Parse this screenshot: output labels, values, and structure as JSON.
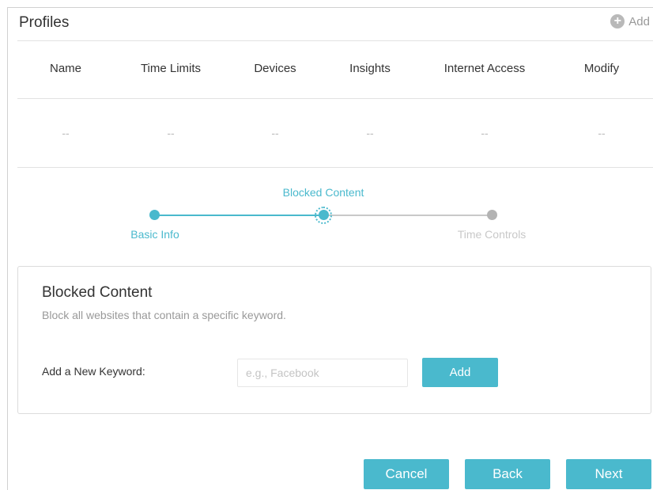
{
  "header": {
    "title": "Profiles",
    "add_label": "Add"
  },
  "table": {
    "columns": [
      "Name",
      "Time Limits",
      "Devices",
      "Insights",
      "Internet Access",
      "Modify"
    ],
    "rows": [
      [
        "--",
        "--",
        "--",
        "--",
        "--",
        "--"
      ]
    ]
  },
  "stepper": {
    "steps": [
      {
        "label": "Basic Info",
        "state": "completed"
      },
      {
        "label": "Blocked Content",
        "state": "active"
      },
      {
        "label": "Time Controls",
        "state": "pending"
      }
    ]
  },
  "card": {
    "title": "Blocked Content",
    "description": "Block all websites that contain a specific keyword.",
    "keyword_label": "Add a New Keyword:",
    "keyword_value": "",
    "keyword_placeholder": "e.g., Facebook",
    "add_button": "Add"
  },
  "buttons": {
    "cancel": "Cancel",
    "back": "Back",
    "next": "Next"
  },
  "colors": {
    "accent": "#4ab9cd",
    "pending": "#b3b3b3"
  }
}
